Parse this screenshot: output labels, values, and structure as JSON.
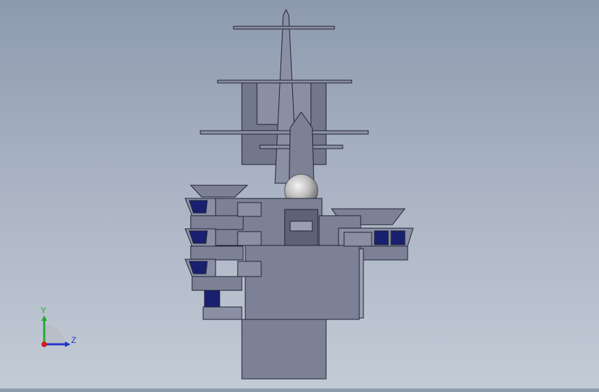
{
  "colors": {
    "background_top": "#8d9aae",
    "background_bottom": "#c3cbd6",
    "hull": "#7c8196",
    "hull_light": "#9a9fb2",
    "hull_dark": "#5d6276",
    "outline": "#1e2130",
    "window": "#1a2070",
    "sphere": "#c8c8c8",
    "axis_x": "#cc2222",
    "axis_y": "#22aa33",
    "axis_z": "#2233cc"
  },
  "model": {
    "name_icon": "ship-island-superstructure-icon",
    "radome_icon": "radar-dome-icon",
    "mast_icon": "mast-icon"
  },
  "triad": {
    "y_label": "Y",
    "z_label": "Z"
  }
}
